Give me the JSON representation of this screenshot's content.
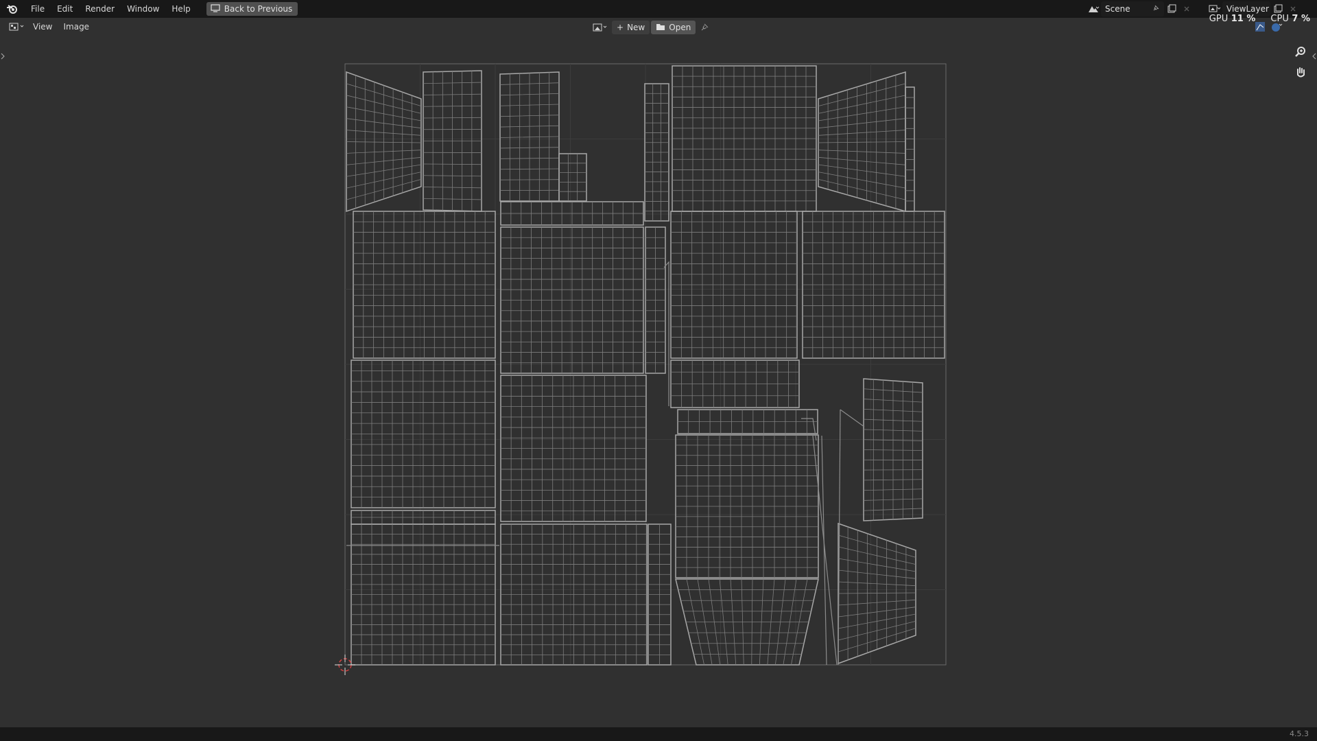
{
  "topbar": {
    "menus": [
      "File",
      "Edit",
      "Render",
      "Window",
      "Help"
    ],
    "back_button": "Back to Previous",
    "scene": "Scene",
    "view_layer": "ViewLayer"
  },
  "stats": {
    "gpu_label": "GPU",
    "gpu_value": "11 %",
    "cpu_label": "CPU",
    "cpu_value": "7 %"
  },
  "header": {
    "menus": [
      "View",
      "Image"
    ],
    "new_button": "New",
    "open_button": "Open"
  },
  "status": {
    "version": "4.5.3"
  },
  "colors": {
    "topbar": "#181818",
    "background": "#303030",
    "wire": "#9a9a9a",
    "cursor": "#c03030"
  }
}
